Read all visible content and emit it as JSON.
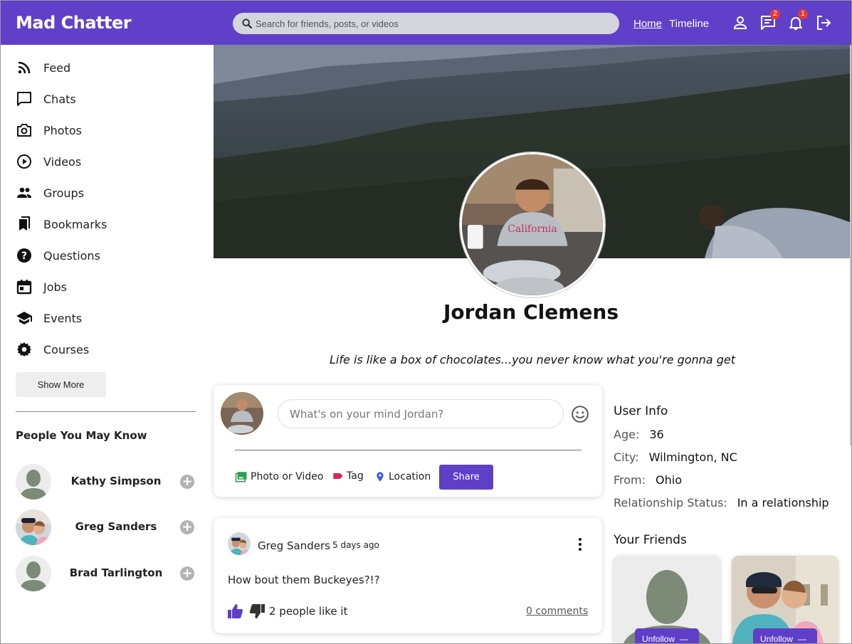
{
  "app": {
    "title": "Mad Chatter"
  },
  "search": {
    "placeholder": "Search for friends, posts, or videos"
  },
  "nav": {
    "home": "Home",
    "timeline": "Timeline"
  },
  "topbar_icons": {
    "profile": "person-icon",
    "messages": {
      "icon": "chat-icon",
      "badge": "2"
    },
    "notifications": {
      "icon": "bell-icon",
      "badge": "1"
    },
    "logout": "logout-icon"
  },
  "colors": {
    "brand": "#6040c9",
    "accent": "#5f3fc7",
    "badge": "#e53935"
  },
  "sidebar": {
    "items": [
      {
        "label": "Feed",
        "icon": "rss-icon"
      },
      {
        "label": "Chats",
        "icon": "chat-bubble-icon"
      },
      {
        "label": "Photos",
        "icon": "camera-icon"
      },
      {
        "label": "Videos",
        "icon": "play-circle-icon"
      },
      {
        "label": "Groups",
        "icon": "group-icon"
      },
      {
        "label": "Bookmarks",
        "icon": "bookmarks-icon"
      },
      {
        "label": "Questions",
        "icon": "question-icon"
      },
      {
        "label": "Jobs",
        "icon": "calendar-icon"
      },
      {
        "label": "Events",
        "icon": "school-icon"
      },
      {
        "label": "Courses",
        "icon": "gear-icon"
      }
    ],
    "show_more": "Show More",
    "people_title": "People You May Know",
    "people": [
      {
        "name": "Kathy Simpson"
      },
      {
        "name": "Greg Sanders"
      },
      {
        "name": "Brad Tarlington"
      }
    ]
  },
  "profile": {
    "name": "Jordan Clemens",
    "bio": "Life is like a box of chocolates...you never know what you're gonna get"
  },
  "composer": {
    "placeholder": "What's on your mind Jordan?",
    "options": {
      "photo": "Photo or Video",
      "tag": "Tag",
      "location": "Location"
    },
    "share": "Share"
  },
  "post": {
    "author": "Greg Sanders",
    "time": "5 days ago",
    "text": "How bout them Buckeyes?!?",
    "likes": "2 people like it",
    "comments": "0 comments"
  },
  "user_info": {
    "title": "User Info",
    "rows": [
      {
        "label": "Age:",
        "value": "36"
      },
      {
        "label": "City:",
        "value": "Wilmington, NC"
      },
      {
        "label": "From:",
        "value": "Ohio"
      },
      {
        "label": "Relationship Status:",
        "value": "In a relationship"
      }
    ]
  },
  "friends": {
    "title": "Your Friends",
    "items": [
      {
        "button": "Unfollow"
      },
      {
        "button": "Unfollow"
      }
    ]
  }
}
